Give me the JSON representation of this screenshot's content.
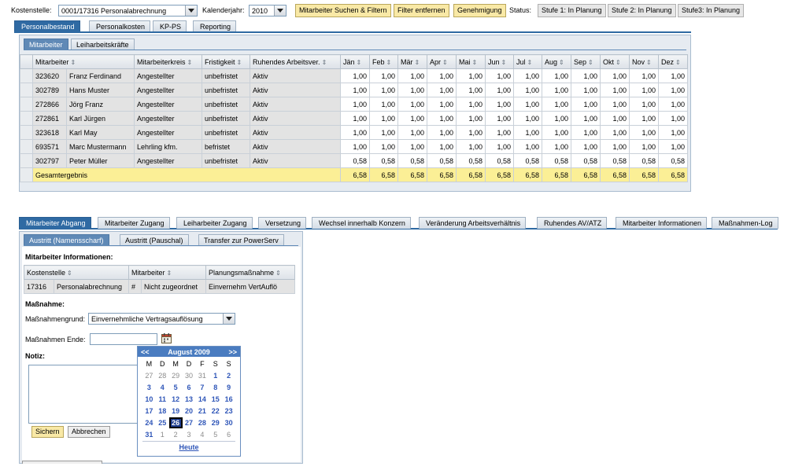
{
  "filters": {
    "cost_center_label": "Kostenstelle:",
    "cost_center_value": "0001/17316 Personalabrechnung",
    "year_label": "Kalenderjahr:",
    "year_value": "2010",
    "search_button": "Mitarbeiter Suchen & Filtern",
    "remove_filter_button": "Filter entfernen",
    "approval_button": "Genehmigung",
    "status_label": "Status:",
    "stages": [
      "Stufe 1: In Planung",
      "Stufe 2: In Planung",
      "Stufe3: In Planung"
    ]
  },
  "main_tabs": [
    "Personalbestand",
    "Personalkosten",
    "KP-PS",
    "Reporting"
  ],
  "sub_tabs": [
    "Mitarbeiter",
    "Leiharbeitskräfte"
  ],
  "table": {
    "columns": [
      "Mitarbeiter",
      "Mitarbeiterkreis",
      "Fristigkeit",
      "Ruhendes Arbeitsver.",
      "Jän",
      "Feb",
      "Mär",
      "Apr",
      "Mai",
      "Jun",
      "Jul",
      "Aug",
      "Sep",
      "Okt",
      "Nov",
      "Dez"
    ],
    "rows": [
      {
        "id": "323620",
        "name": "Franz Ferdinand",
        "kreis": "Angestellter",
        "frist": "unbefristet",
        "ruhend": "Aktiv",
        "months": [
          "1,00",
          "1,00",
          "1,00",
          "1,00",
          "1,00",
          "1,00",
          "1,00",
          "1,00",
          "1,00",
          "1,00",
          "1,00",
          "1,00"
        ]
      },
      {
        "id": "302789",
        "name": "Hans Muster",
        "kreis": "Angestellter",
        "frist": "unbefristet",
        "ruhend": "Aktiv",
        "months": [
          "1,00",
          "1,00",
          "1,00",
          "1,00",
          "1,00",
          "1,00",
          "1,00",
          "1,00",
          "1,00",
          "1,00",
          "1,00",
          "1,00"
        ]
      },
      {
        "id": "272866",
        "name": "Jörg Franz",
        "kreis": "Angestellter",
        "frist": "unbefristet",
        "ruhend": "Aktiv",
        "months": [
          "1,00",
          "1,00",
          "1,00",
          "1,00",
          "1,00",
          "1,00",
          "1,00",
          "1,00",
          "1,00",
          "1,00",
          "1,00",
          "1,00"
        ]
      },
      {
        "id": "272861",
        "name": "Karl Jürgen",
        "kreis": "Angestellter",
        "frist": "unbefristet",
        "ruhend": "Aktiv",
        "months": [
          "1,00",
          "1,00",
          "1,00",
          "1,00",
          "1,00",
          "1,00",
          "1,00",
          "1,00",
          "1,00",
          "1,00",
          "1,00",
          "1,00"
        ]
      },
      {
        "id": "323618",
        "name": "Karl May",
        "kreis": "Angestellter",
        "frist": "unbefristet",
        "ruhend": "Aktiv",
        "months": [
          "1,00",
          "1,00",
          "1,00",
          "1,00",
          "1,00",
          "1,00",
          "1,00",
          "1,00",
          "1,00",
          "1,00",
          "1,00",
          "1,00"
        ]
      },
      {
        "id": "693571",
        "name": "Marc Mustermann",
        "kreis": "Lehrling kfm.",
        "frist": "befristet",
        "ruhend": "Aktiv",
        "months": [
          "1,00",
          "1,00",
          "1,00",
          "1,00",
          "1,00",
          "1,00",
          "1,00",
          "1,00",
          "1,00",
          "1,00",
          "1,00",
          "1,00"
        ]
      },
      {
        "id": "302797",
        "name": "Peter Müller",
        "kreis": "Angestellter",
        "frist": "unbefristet",
        "ruhend": "Aktiv",
        "months": [
          "0,58",
          "0,58",
          "0,58",
          "0,58",
          "0,58",
          "0,58",
          "0,58",
          "0,58",
          "0,58",
          "0,58",
          "0,58",
          "0,58"
        ]
      }
    ],
    "total_label": "Gesamtergebnis",
    "totals": [
      "6,58",
      "6,58",
      "6,58",
      "6,58",
      "6,58",
      "6,58",
      "6,58",
      "6,58",
      "6,58",
      "6,58",
      "6,58",
      "6,58"
    ]
  },
  "lower_tabs": [
    "Mitarbeiter Abgang",
    "Mitarbeiter Zugang",
    "Leiharbeiter Zugang",
    "Versetzung",
    "Wechsel innerhalb Konzern",
    "Veränderung Arbeitsverhältnis",
    "Ruhendes AV/ATZ",
    "Mitarbeiter Informationen",
    "Maßnahmen-Log"
  ],
  "lower_sub_tabs": [
    "Austritt (Namensscharf)",
    "Austritt (Pauschal)",
    "Transfer zur PowerServ"
  ],
  "info": {
    "title": "Mitarbeiter Informationen:",
    "columns": [
      "Kostenstelle",
      "Mitarbeiter",
      "Planungsmaßnahme"
    ],
    "row": {
      "kst_id": "17316",
      "kst_name": "Personalabrechnung",
      "hash": "#",
      "mitarbeiter": "Nicht zugeordnet",
      "massnahme": "Einvernehm VertAuflö"
    }
  },
  "massnahme": {
    "title": "Maßnahme:",
    "grund_label": "Maßnahmengrund:",
    "grund_value": "Einvernehmliche Vertragsauflösung",
    "ende_label": "Maßnahmen Ende:",
    "ende_value": "",
    "notiz_label": "Notiz:",
    "save_button": "Sichern",
    "cancel_button": "Abbrechen"
  },
  "calendar": {
    "prev": "<<",
    "next": ">>",
    "month_title": "August 2009",
    "weekdays": [
      "M",
      "D",
      "M",
      "D",
      "F",
      "S",
      "S"
    ],
    "weeks": [
      [
        {
          "d": "27",
          "o": true
        },
        {
          "d": "28",
          "o": true
        },
        {
          "d": "29",
          "o": true
        },
        {
          "d": "30",
          "o": true
        },
        {
          "d": "31",
          "o": true
        },
        {
          "d": "1"
        },
        {
          "d": "2"
        }
      ],
      [
        {
          "d": "3"
        },
        {
          "d": "4"
        },
        {
          "d": "5"
        },
        {
          "d": "6"
        },
        {
          "d": "7"
        },
        {
          "d": "8"
        },
        {
          "d": "9"
        }
      ],
      [
        {
          "d": "10"
        },
        {
          "d": "11"
        },
        {
          "d": "12"
        },
        {
          "d": "13"
        },
        {
          "d": "14"
        },
        {
          "d": "15"
        },
        {
          "d": "16"
        }
      ],
      [
        {
          "d": "17"
        },
        {
          "d": "18"
        },
        {
          "d": "19"
        },
        {
          "d": "20"
        },
        {
          "d": "21"
        },
        {
          "d": "22"
        },
        {
          "d": "23"
        }
      ],
      [
        {
          "d": "24"
        },
        {
          "d": "25"
        },
        {
          "d": "26",
          "t": true
        },
        {
          "d": "27"
        },
        {
          "d": "28"
        },
        {
          "d": "29"
        },
        {
          "d": "30"
        }
      ],
      [
        {
          "d": "31"
        },
        {
          "d": "1",
          "o": true
        },
        {
          "d": "2",
          "o": true
        },
        {
          "d": "3",
          "o": true
        },
        {
          "d": "4",
          "o": true
        },
        {
          "d": "5",
          "o": true
        },
        {
          "d": "6",
          "o": true
        }
      ]
    ],
    "today_label": "Heute"
  }
}
